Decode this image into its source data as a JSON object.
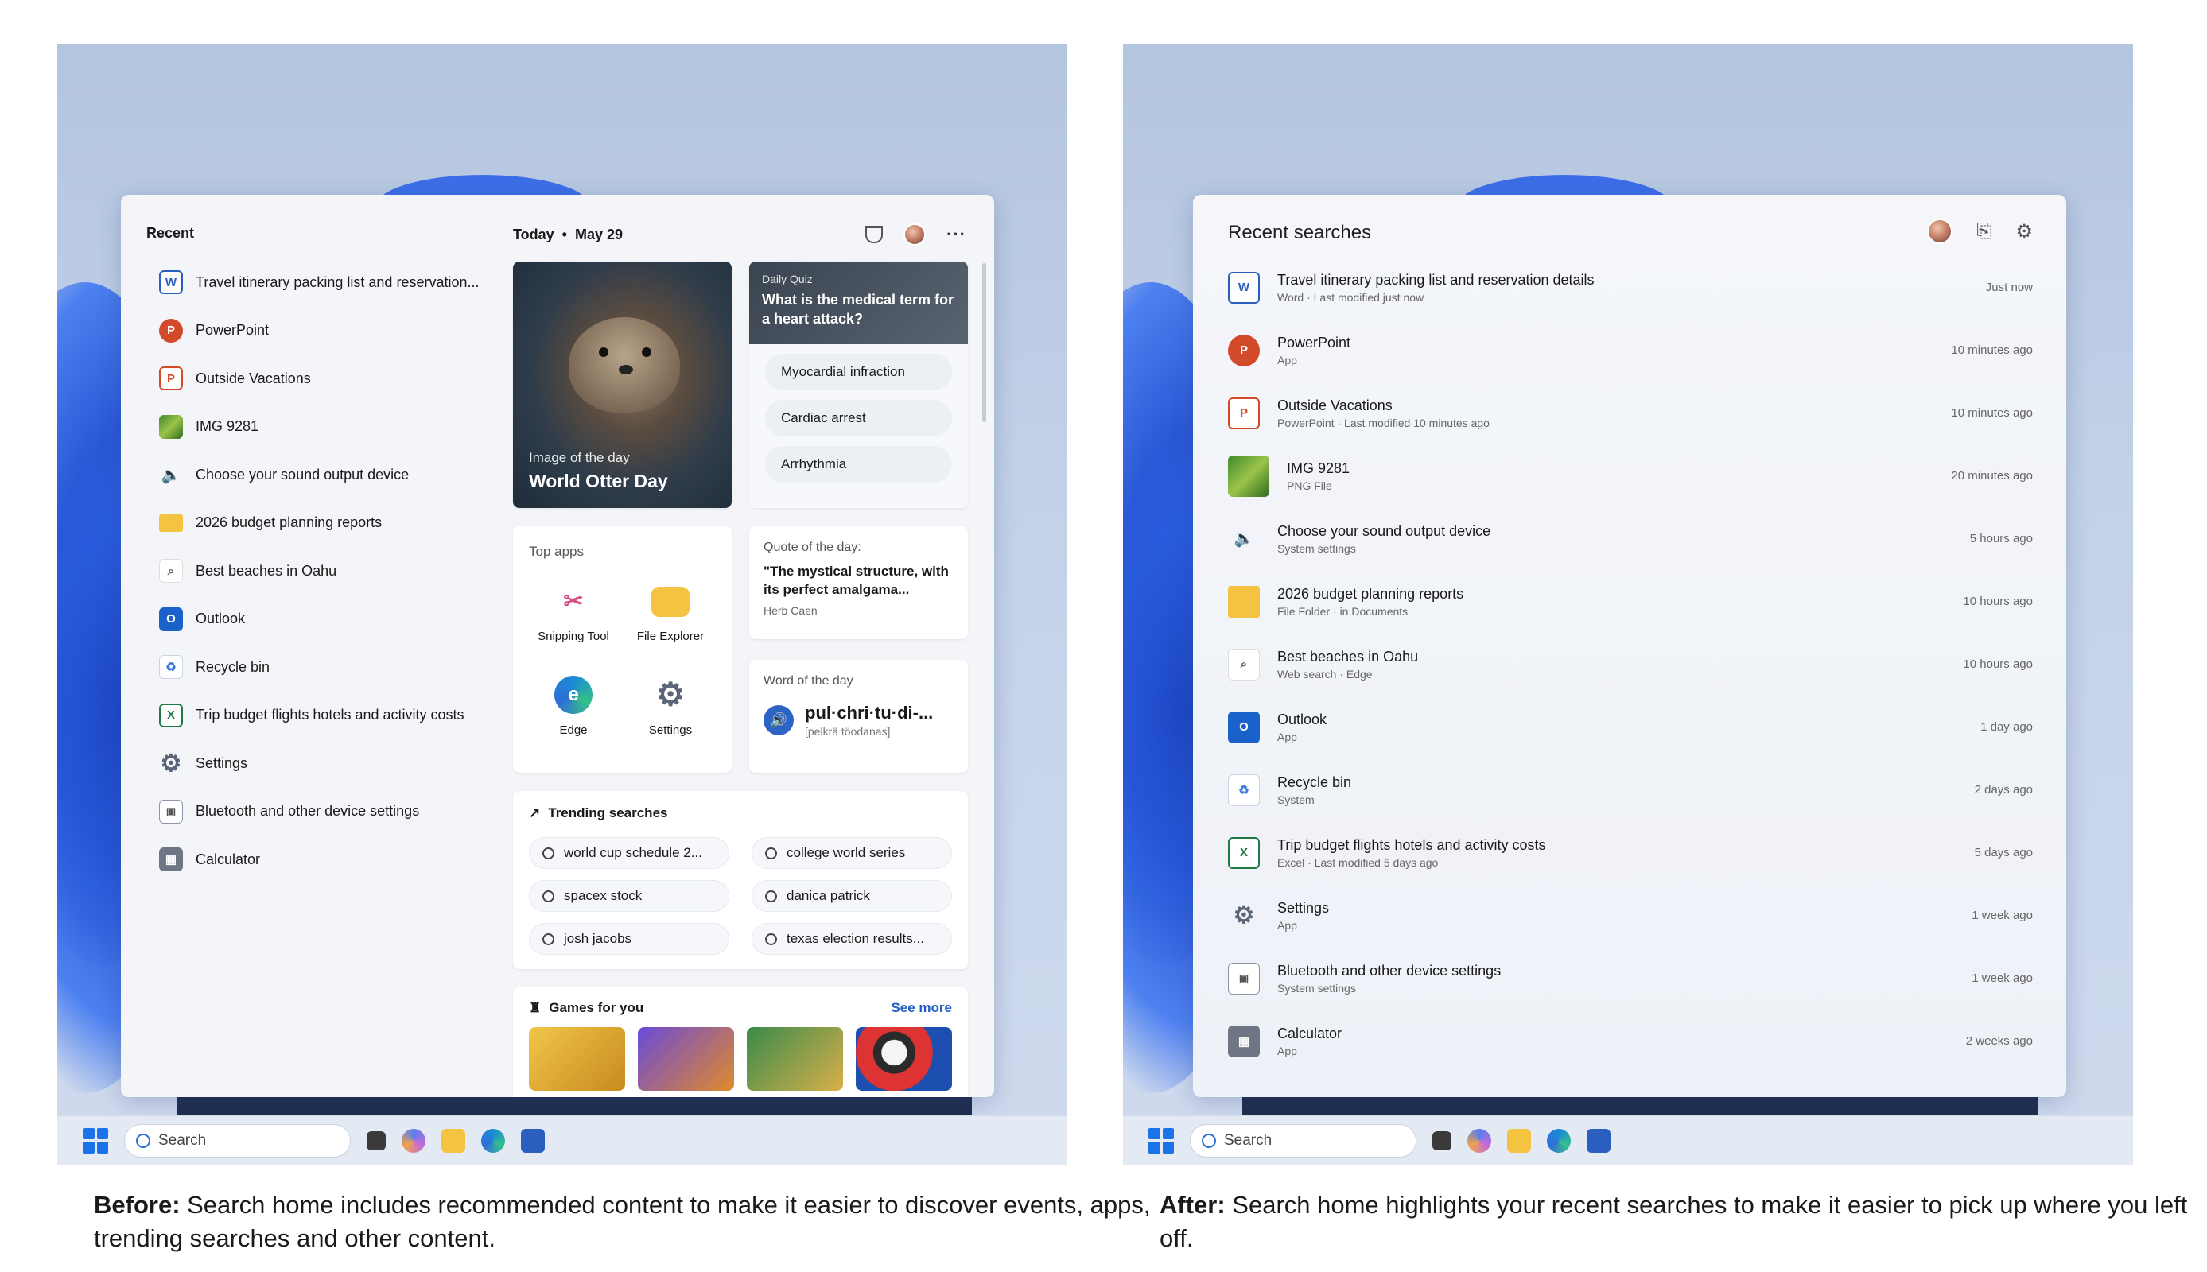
{
  "before": {
    "recent_title": "Recent",
    "recent_items": [
      {
        "label": "Travel itinerary packing list and reservation...",
        "icon": "word-doc-icon"
      },
      {
        "label": "PowerPoint",
        "icon": "powerpoint-icon"
      },
      {
        "label": "Outside Vacations",
        "icon": "powerpoint-file-icon"
      },
      {
        "label": "IMG 9281",
        "icon": "image-thumbnail-icon"
      },
      {
        "label": "Choose your sound output device",
        "icon": "speaker-icon"
      },
      {
        "label": "2026 budget planning reports",
        "icon": "folder-icon"
      },
      {
        "label": "Best beaches in Oahu",
        "icon": "search-icon"
      },
      {
        "label": "Outlook",
        "icon": "outlook-icon"
      },
      {
        "label": "Recycle bin",
        "icon": "recycle-bin-icon"
      },
      {
        "label": "Trip budget flights hotels and activity costs",
        "icon": "excel-file-icon"
      },
      {
        "label": "Settings",
        "icon": "gear-icon"
      },
      {
        "label": "Bluetooth and other device settings",
        "icon": "bluetooth-device-icon"
      },
      {
        "label": "Calculator",
        "icon": "calculator-icon"
      }
    ],
    "today_label": "Today",
    "date_label": "May 29",
    "image_of_day": {
      "label": "Image of the day",
      "title": "World Otter Day"
    },
    "quiz": {
      "label": "Daily Quiz",
      "question": "What is the medical term for a heart attack?",
      "options": [
        "Myocardial infraction",
        "Cardiac arrest",
        "Arrhythmia"
      ]
    },
    "top_apps": {
      "title": "Top apps",
      "apps": [
        {
          "label": "Snipping Tool",
          "icon": "snipping-tool-icon"
        },
        {
          "label": "File Explorer",
          "icon": "file-explorer-icon"
        },
        {
          "label": "Edge",
          "icon": "edge-icon"
        },
        {
          "label": "Settings",
          "icon": "settings-gear-icon"
        }
      ]
    },
    "quote": {
      "label": "Quote of the day:",
      "text": "\"The mystical structure, with its perfect amalgama...",
      "author": "Herb Caen"
    },
    "word": {
      "label": "Word of the day",
      "word": "pul·chri·tu·di-...",
      "pronunciation": "[pelkrä töodanas]"
    },
    "trending": {
      "title": "Trending searches",
      "items": [
        "world cup schedule 2...",
        "college world series",
        "spacex stock",
        "danica patrick",
        "josh jacobs",
        "texas election results..."
      ]
    },
    "games": {
      "title": "Games for you",
      "see_more": "See more"
    },
    "search_placeholder": "Search"
  },
  "after": {
    "title": "Recent searches",
    "items": [
      {
        "name": "Travel itinerary packing list and reservation details",
        "sub": "Word · Last modified just now",
        "time": "Just now",
        "icon": "word-doc-icon"
      },
      {
        "name": "PowerPoint",
        "sub": "App",
        "time": "10 minutes ago",
        "icon": "powerpoint-icon"
      },
      {
        "name": "Outside Vacations",
        "sub": "PowerPoint · Last modified 10 minutes ago",
        "time": "10 minutes ago",
        "icon": "powerpoint-file-icon"
      },
      {
        "name": "IMG 9281",
        "sub": "PNG File",
        "time": "20 minutes ago",
        "icon": "image-thumbnail-icon"
      },
      {
        "name": "Choose your sound output device",
        "sub": "System settings",
        "time": "5 hours ago",
        "icon": "speaker-icon"
      },
      {
        "name": "2026 budget planning reports",
        "sub": "File Folder · in Documents",
        "time": "10 hours ago",
        "icon": "folder-icon"
      },
      {
        "name": "Best beaches in Oahu",
        "sub": "Web search · Edge",
        "time": "10 hours ago",
        "icon": "search-icon"
      },
      {
        "name": "Outlook",
        "sub": "App",
        "time": "1 day ago",
        "icon": "outlook-icon"
      },
      {
        "name": "Recycle bin",
        "sub": "System",
        "time": "2 days ago",
        "icon": "recycle-bin-icon"
      },
      {
        "name": "Trip budget flights hotels and activity costs",
        "sub": "Excel · Last modified 5 days ago",
        "time": "5 days ago",
        "icon": "excel-file-icon"
      },
      {
        "name": "Settings",
        "sub": "App",
        "time": "1 week ago",
        "icon": "gear-icon"
      },
      {
        "name": "Bluetooth and other device settings",
        "sub": "System settings",
        "time": "1 week ago",
        "icon": "bluetooth-device-icon"
      },
      {
        "name": "Calculator",
        "sub": "App",
        "time": "2 weeks ago",
        "icon": "calculator-icon"
      }
    ],
    "search_placeholder": "Search"
  },
  "captions": {
    "before_bold": "Before:",
    "before_text": " Search home includes recommended content to make it easier to discover events, apps, trending searches and other content.",
    "after_bold": "After:",
    "after_text": " Search home highlights your recent searches to make it easier to pick up where you left off."
  }
}
